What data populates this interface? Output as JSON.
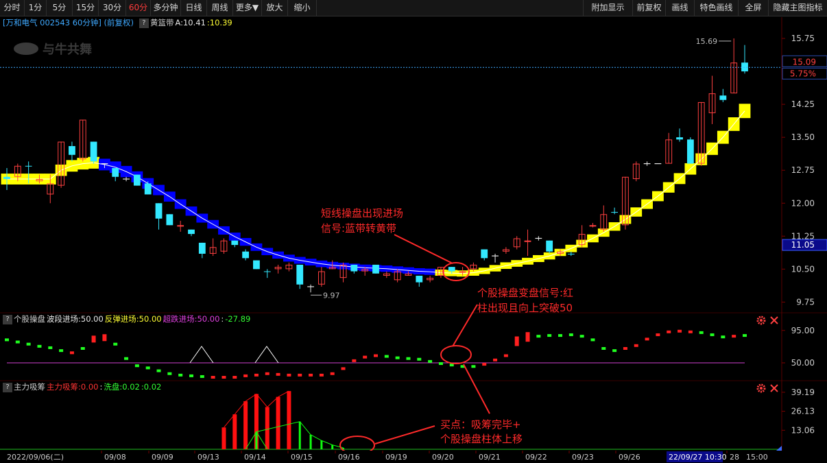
{
  "toolbar": {
    "left": [
      {
        "label": "分时",
        "active": false
      },
      {
        "label": "1分",
        "active": false
      },
      {
        "label": "5分",
        "active": false
      },
      {
        "label": "15分",
        "active": false
      },
      {
        "label": "30分",
        "active": false
      },
      {
        "label": "60分",
        "active": true
      },
      {
        "label": "多分钟",
        "active": false
      },
      {
        "label": "日线",
        "active": false
      },
      {
        "label": "周线",
        "active": false
      },
      {
        "label": "更多▼",
        "active": false
      },
      {
        "label": "放大",
        "active": false
      },
      {
        "label": "缩小",
        "active": false
      }
    ],
    "right": [
      "附加显示",
      "前复权",
      "画线",
      "特色画线",
      "全屏",
      "隐藏主图指标"
    ]
  },
  "header": {
    "stock": "[万和电气 002543 60分钟] (前复权)",
    "q": "?",
    "indicator": "黄篮带",
    "a_value": "A:10.41",
    "b_value": ":10.39",
    "watermark": "与牛共舞"
  },
  "panel2_header": {
    "q": "?",
    "name": "个股操盘",
    "l1": "波段进场:50.00",
    "l2": "反弹进场:50.00",
    "l3": "超跌进场:50.00",
    "l4": ":",
    "l5": "-27.89"
  },
  "panel3_header": {
    "q": "?",
    "name": "主力吸筹",
    "l1": "主力吸筹:0.00",
    "l2": ":",
    "l3": "洗盘:0.02",
    "l4": ":0.02"
  },
  "price_axis": {
    "ticks": [
      "15.75",
      "15.00",
      "14.25",
      "13.50",
      "12.75",
      "12.00",
      "11.25",
      "10.50",
      "9.75"
    ],
    "current_price": "15.09",
    "pct_change": "5.75%",
    "box_price": "11.05",
    "hi_label": "15.69",
    "lo_label": "9.97"
  },
  "ind1_axis": [
    "95.00",
    "50.00"
  ],
  "ind2_axis": [
    "39.19",
    "26.13",
    "13.06"
  ],
  "time_axis": {
    "labels": [
      "2022/09/06(二)",
      "09/08",
      "09/09",
      "09/13",
      "09/14",
      "09/15",
      "09/16",
      "09/19",
      "09/20",
      "09/21",
      "09/22",
      "09/23",
      "09/26",
      "28",
      "15:00"
    ],
    "cursor_label": "22/09/27 10:30"
  },
  "annotations": {
    "a1_line1": "短线操盘出现进场",
    "a1_line2": "信号:蓝带转黄带",
    "a2_line1": "个股操盘变盘信号:红",
    "a2_line2": "柱出现且向上突破50",
    "a3_line1": "买点：吸筹完毕+",
    "a3_line2": "个股操盘柱体上移"
  },
  "chart_data": [
    {
      "type": "candlestick",
      "title": "万和电气 002543 60分钟 (前复权)",
      "ylim": [
        9.6,
        16.0
      ],
      "yticks": [
        15.75,
        15.0,
        14.25,
        13.5,
        12.75,
        12.0,
        11.25,
        10.5,
        9.75
      ],
      "x": [
        "09/06",
        "09/08",
        "09/09",
        "09/13",
        "09/14",
        "09/15",
        "09/16",
        "09/19",
        "09/20",
        "09/21",
        "09/22",
        "09/23",
        "09/26",
        "09/27",
        "09/28"
      ],
      "candles": [
        [
          12.55,
          12.8,
          12.6,
          12.3,
          "c"
        ],
        [
          12.6,
          12.9,
          12.85,
          12.5,
          "r"
        ],
        [
          12.85,
          12.95,
          12.85,
          12.45,
          "c"
        ],
        [
          12.55,
          12.65,
          12.5,
          12.45,
          "r"
        ],
        [
          12.2,
          12.65,
          12.45,
          12.0,
          "r"
        ],
        [
          12.4,
          13.4,
          13.4,
          12.35,
          "r"
        ],
        [
          13.3,
          13.4,
          13.1,
          12.95,
          "c"
        ],
        [
          13.0,
          13.9,
          13.9,
          12.95,
          "r"
        ],
        [
          13.4,
          13.4,
          12.95,
          12.9,
          "c"
        ],
        [
          12.9,
          12.9,
          12.85,
          12.8,
          "w"
        ],
        [
          12.8,
          12.8,
          12.6,
          12.5,
          "c"
        ],
        [
          12.55,
          12.6,
          12.55,
          12.5,
          "w"
        ],
        [
          12.65,
          12.65,
          12.4,
          12.4,
          "c"
        ],
        [
          12.45,
          12.5,
          12.2,
          12.2,
          "c"
        ],
        [
          12.0,
          12.0,
          11.65,
          11.4,
          "c"
        ],
        [
          11.75,
          11.75,
          11.5,
          11.5,
          "c"
        ],
        [
          11.5,
          11.6,
          11.5,
          11.35,
          "r"
        ],
        [
          11.4,
          11.4,
          11.3,
          11.25,
          "c"
        ],
        [
          11.1,
          11.1,
          10.85,
          10.75,
          "c"
        ],
        [
          10.85,
          11.2,
          11.0,
          10.8,
          "r"
        ],
        [
          10.9,
          11.2,
          11.15,
          10.85,
          "r"
        ],
        [
          11.15,
          11.15,
          11.05,
          11.0,
          "c"
        ],
        [
          10.9,
          10.95,
          10.75,
          10.7,
          "c"
        ],
        [
          10.7,
          10.7,
          10.5,
          10.5,
          "c"
        ],
        [
          10.45,
          10.5,
          10.45,
          10.3,
          "c"
        ],
        [
          10.5,
          10.6,
          10.55,
          10.4,
          "r"
        ],
        [
          10.5,
          10.65,
          10.6,
          10.45,
          "r"
        ],
        [
          10.6,
          10.6,
          10.15,
          10.05,
          "c"
        ],
        [
          10.1,
          10.15,
          10.1,
          9.97,
          "w"
        ],
        [
          10.15,
          10.55,
          10.45,
          10.1,
          "r"
        ],
        [
          10.5,
          10.7,
          10.55,
          10.5,
          "r"
        ],
        [
          10.3,
          10.65,
          10.6,
          10.2,
          "r"
        ],
        [
          10.6,
          10.6,
          10.45,
          10.4,
          "c"
        ],
        [
          10.45,
          10.55,
          10.5,
          10.35,
          "r"
        ],
        [
          10.6,
          10.6,
          10.4,
          10.4,
          "c"
        ],
        [
          10.35,
          10.45,
          10.4,
          10.3,
          "r"
        ],
        [
          10.25,
          10.5,
          10.45,
          10.2,
          "r"
        ],
        [
          10.35,
          10.45,
          10.4,
          10.35,
          "r"
        ],
        [
          10.35,
          10.35,
          10.2,
          10.1,
          "c"
        ],
        [
          10.25,
          10.35,
          10.3,
          10.2,
          "r"
        ],
        [
          10.35,
          10.55,
          10.55,
          10.3,
          "r"
        ],
        [
          10.55,
          10.55,
          10.45,
          10.4,
          "c"
        ],
        [
          10.45,
          10.55,
          10.45,
          10.35,
          "r"
        ],
        [
          10.5,
          10.65,
          10.6,
          10.45,
          "r"
        ],
        [
          10.75,
          10.95,
          10.95,
          10.7,
          "c"
        ],
        [
          10.75,
          10.85,
          10.8,
          10.65,
          "w"
        ],
        [
          10.9,
          11.0,
          10.95,
          10.85,
          "r"
        ],
        [
          11.0,
          11.25,
          11.2,
          10.95,
          "r"
        ],
        [
          11.15,
          11.4,
          11.15,
          10.8,
          "r"
        ],
        [
          11.2,
          11.25,
          11.2,
          11.15,
          "w"
        ],
        [
          11.15,
          11.15,
          10.9,
          10.85,
          "c"
        ],
        [
          10.85,
          10.95,
          10.9,
          10.8,
          "r"
        ],
        [
          10.85,
          10.9,
          10.85,
          10.8,
          "c"
        ],
        [
          11.05,
          11.5,
          11.3,
          11.0,
          "r"
        ],
        [
          11.5,
          11.55,
          11.5,
          11.45,
          "r"
        ],
        [
          11.4,
          11.95,
          11.75,
          11.35,
          "r"
        ],
        [
          11.8,
          11.9,
          11.8,
          11.75,
          "c"
        ],
        [
          11.5,
          12.6,
          12.6,
          11.4,
          "r"
        ],
        [
          12.55,
          12.95,
          12.9,
          12.5,
          "r"
        ],
        [
          12.9,
          12.95,
          12.9,
          12.85,
          "w"
        ],
        [
          12.9,
          12.9,
          12.9,
          12.9,
          "w"
        ],
        [
          12.9,
          13.6,
          13.45,
          12.9,
          "r"
        ],
        [
          13.5,
          13.7,
          13.45,
          13.4,
          "c"
        ],
        [
          13.45,
          13.5,
          12.9,
          12.9,
          "c"
        ],
        [
          12.9,
          14.3,
          14.3,
          12.85,
          "r"
        ],
        [
          14.05,
          14.9,
          14.5,
          13.8,
          "r"
        ],
        [
          14.45,
          14.6,
          14.35,
          14.3,
          "c"
        ],
        [
          14.5,
          15.75,
          15.2,
          14.5,
          "r"
        ],
        [
          15.2,
          15.6,
          15.0,
          14.95,
          "c"
        ]
      ],
      "band": [
        12.55,
        12.55,
        12.55,
        12.55,
        12.55,
        12.75,
        12.85,
        12.9,
        12.92,
        12.88,
        12.82,
        12.72,
        12.6,
        12.45,
        12.3,
        12.15,
        11.98,
        11.82,
        11.66,
        11.52,
        11.38,
        11.24,
        11.12,
        11.0,
        10.9,
        10.82,
        10.75,
        10.7,
        10.66,
        10.62,
        10.59,
        10.57,
        10.55,
        10.53,
        10.52,
        10.51,
        10.49,
        10.47,
        10.45,
        10.44,
        10.42,
        10.41,
        10.4,
        10.42,
        10.46,
        10.52,
        10.58,
        10.63,
        10.68,
        10.74,
        10.8,
        10.88,
        10.97,
        11.08,
        11.2,
        11.33,
        11.47,
        11.63,
        11.8,
        11.98,
        12.16,
        12.36,
        12.56,
        12.78,
        13.0,
        13.24,
        13.5,
        13.8,
        14.1
      ],
      "band_color": [
        "y",
        "y",
        "y",
        "y",
        "y",
        "y",
        "y",
        "y",
        "y",
        "b",
        "b",
        "b",
        "b",
        "b",
        "b",
        "b",
        "b",
        "b",
        "b",
        "b",
        "b",
        "b",
        "b",
        "b",
        "b",
        "b",
        "b",
        "b",
        "b",
        "b",
        "b",
        "b",
        "b",
        "b",
        "b",
        "b",
        "b",
        "b",
        "b",
        "b",
        "y",
        "y",
        "y",
        "y",
        "y",
        "y",
        "y",
        "y",
        "y",
        "y",
        "y",
        "y",
        "y",
        "y",
        "y",
        "y",
        "y",
        "y",
        "y",
        "y",
        "y",
        "y",
        "y",
        "y",
        "y",
        "y",
        "y",
        "y",
        "y"
      ],
      "current_price": 15.09,
      "pct_change": "5.75%",
      "box_price": 11.05,
      "high_mark": 15.69,
      "low_mark": 9.97
    },
    {
      "type": "scatter",
      "title": "个股操盘",
      "yticks": [
        95.0,
        50.0
      ],
      "ylim": [
        30,
        110
      ],
      "reference": 50.0,
      "values": [
        82,
        79,
        76,
        73,
        71,
        67,
        64,
        70,
        83,
        85,
        76,
        56,
        46,
        43,
        39,
        35,
        33,
        32,
        31,
        30,
        30,
        30,
        32,
        33,
        35,
        34,
        33,
        33,
        33,
        33,
        35,
        42,
        53,
        58,
        60,
        59,
        57,
        56,
        55,
        52,
        49,
        47,
        45,
        45,
        48,
        54,
        60,
        80,
        86,
        87,
        88,
        88,
        89,
        87,
        82,
        70,
        67,
        70,
        74,
        83,
        89,
        93,
        94,
        93,
        92,
        89,
        86,
        87,
        88
      ],
      "colors": [
        "g",
        "g",
        "g",
        "g",
        "g",
        "g",
        "r",
        "g",
        "r",
        "r",
        "g",
        "g",
        "g",
        "g",
        "g",
        "g",
        "g",
        "g",
        "g",
        "r",
        "r",
        "r",
        "r",
        "r",
        "r",
        "r",
        "r",
        "r",
        "r",
        "r",
        "r",
        "r",
        "r",
        "r",
        "r",
        "g",
        "g",
        "g",
        "g",
        "g",
        "g",
        "g",
        "g",
        "g",
        "r",
        "r",
        "r",
        "r",
        "r",
        "g",
        "g",
        "g",
        "g",
        "g",
        "g",
        "g",
        "g",
        "r",
        "r",
        "r",
        "r",
        "r",
        "r",
        "r",
        "g",
        "g",
        "g",
        "r",
        "g"
      ],
      "triangles_at": [
        17,
        23
      ]
    },
    {
      "type": "bar",
      "title": "主力吸筹",
      "yticks": [
        39.19,
        26.13,
        13.06
      ],
      "ylim": [
        0,
        41
      ],
      "red": [
        [
          20,
          15
        ],
        [
          21,
          24
        ],
        [
          22,
          33
        ],
        [
          23,
          38
        ],
        [
          24,
          29
        ],
        [
          25,
          36
        ],
        [
          26,
          40
        ]
      ],
      "green": [
        [
          23,
          12
        ],
        [
          27,
          19
        ],
        [
          28,
          10
        ],
        [
          29,
          6
        ],
        [
          30,
          3
        ],
        [
          31,
          1
        ]
      ]
    }
  ]
}
